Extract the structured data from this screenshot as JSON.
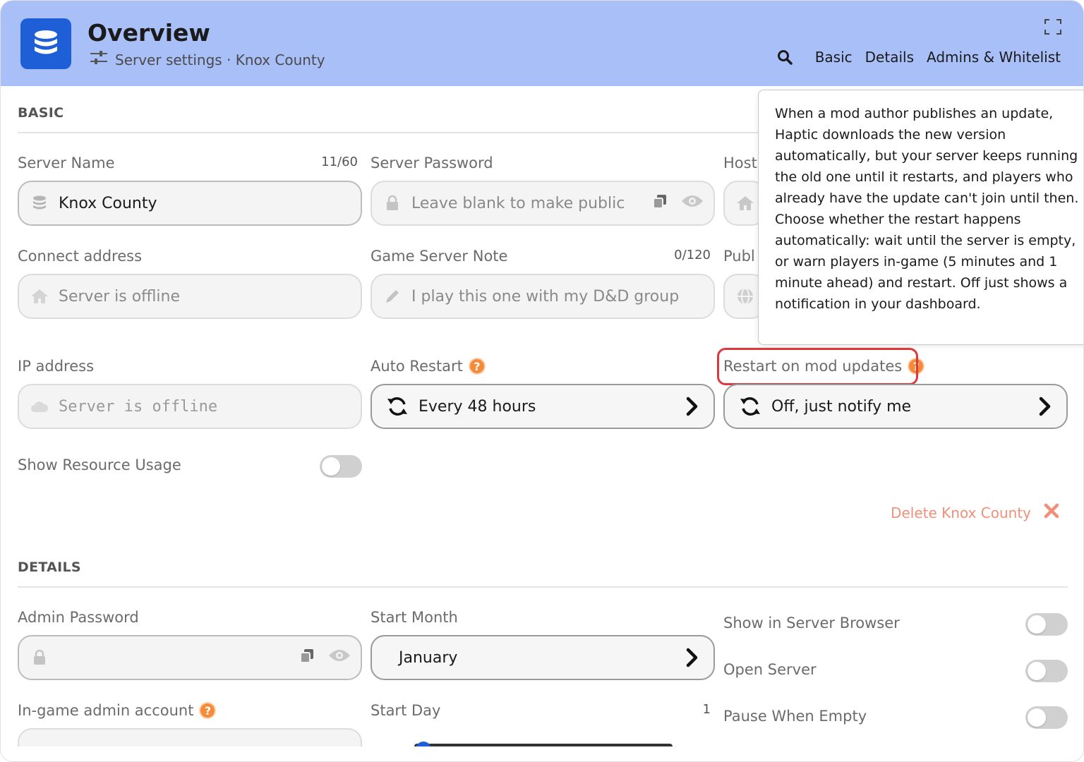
{
  "header": {
    "title": "Overview",
    "subtitle": "Server settings · Knox County",
    "nav": [
      "Basic",
      "Details",
      "Admins & Whitelist"
    ]
  },
  "basic": {
    "heading": "BASIC",
    "server_name": {
      "label": "Server Name",
      "counter": "11/60",
      "value": "Knox County"
    },
    "server_password": {
      "label": "Server Password",
      "placeholder": "Leave blank to make public"
    },
    "host_label": "Host",
    "connect_address": {
      "label": "Connect address",
      "placeholder": "Server is offline"
    },
    "game_server_note": {
      "label": "Game Server Note",
      "counter": "0/120",
      "placeholder": "I play this one with my D&D group"
    },
    "public_label": "Publ",
    "ip_address": {
      "label": "IP address",
      "placeholder": "Server is offline"
    },
    "auto_restart": {
      "label": "Auto Restart",
      "value": "Every 48 hours"
    },
    "restart_on_mod": {
      "label": "Restart on mod updates",
      "value": "Off, just notify me"
    },
    "show_resource_usage": {
      "label": "Show Resource Usage",
      "on": false
    },
    "delete_label": "Delete Knox County"
  },
  "tooltip": {
    "text": "When a mod author publishes an update, Haptic downloads the new version automatically, but your server keeps running the old one until it restarts, and players who already have the update can't join until then. Choose whether the restart happens automatically: wait until the server is empty, or warn players in-game (5 minutes and 1 minute ahead) and restart. Off just shows a notification in your dashboard."
  },
  "details": {
    "heading": "DETAILS",
    "admin_password": {
      "label": "Admin Password"
    },
    "start_month": {
      "label": "Start Month",
      "value": "January"
    },
    "show_in_browser": {
      "label": "Show in Server Browser",
      "on": false
    },
    "open_server": {
      "label": "Open Server",
      "on": false
    },
    "ingame_admin": {
      "label": "In-game admin account"
    },
    "start_day": {
      "label": "Start Day",
      "value": "1"
    },
    "pause_when_empty": {
      "label": "Pause When Empty",
      "on": false
    }
  },
  "colors": {
    "header_bg": "#a9bff8",
    "accent": "#1e5fd8",
    "help_orange": "#f58a38",
    "danger": "#e0373d",
    "delete_text": "#f0907a"
  }
}
